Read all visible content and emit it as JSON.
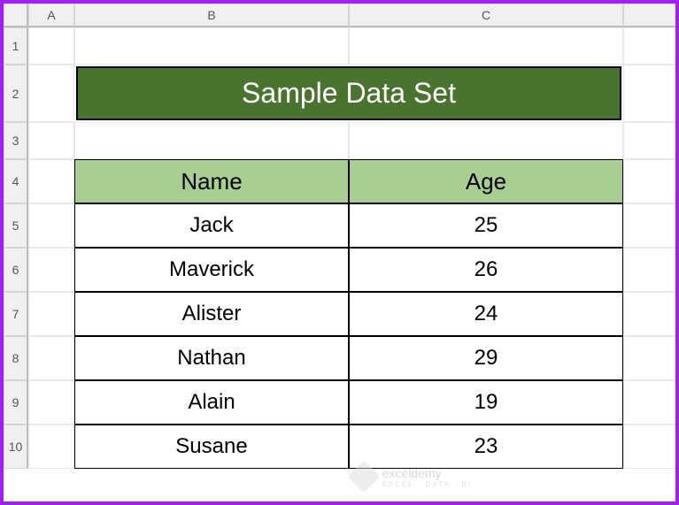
{
  "columns": [
    "A",
    "B",
    "C"
  ],
  "rows": [
    "1",
    "2",
    "3",
    "4",
    "5",
    "6",
    "7",
    "8",
    "9",
    "10"
  ],
  "title": "Sample Data Set",
  "table": {
    "headers": {
      "name": "Name",
      "age": "Age"
    },
    "data": [
      {
        "name": "Jack",
        "age": "25"
      },
      {
        "name": "Maverick",
        "age": "26"
      },
      {
        "name": "Alister",
        "age": "24"
      },
      {
        "name": "Nathan",
        "age": "29"
      },
      {
        "name": "Alain",
        "age": "19"
      },
      {
        "name": "Susane",
        "age": "23"
      }
    ]
  },
  "watermark": {
    "main": "exceldemy",
    "sub": "EXCEL · DATA · BI"
  }
}
